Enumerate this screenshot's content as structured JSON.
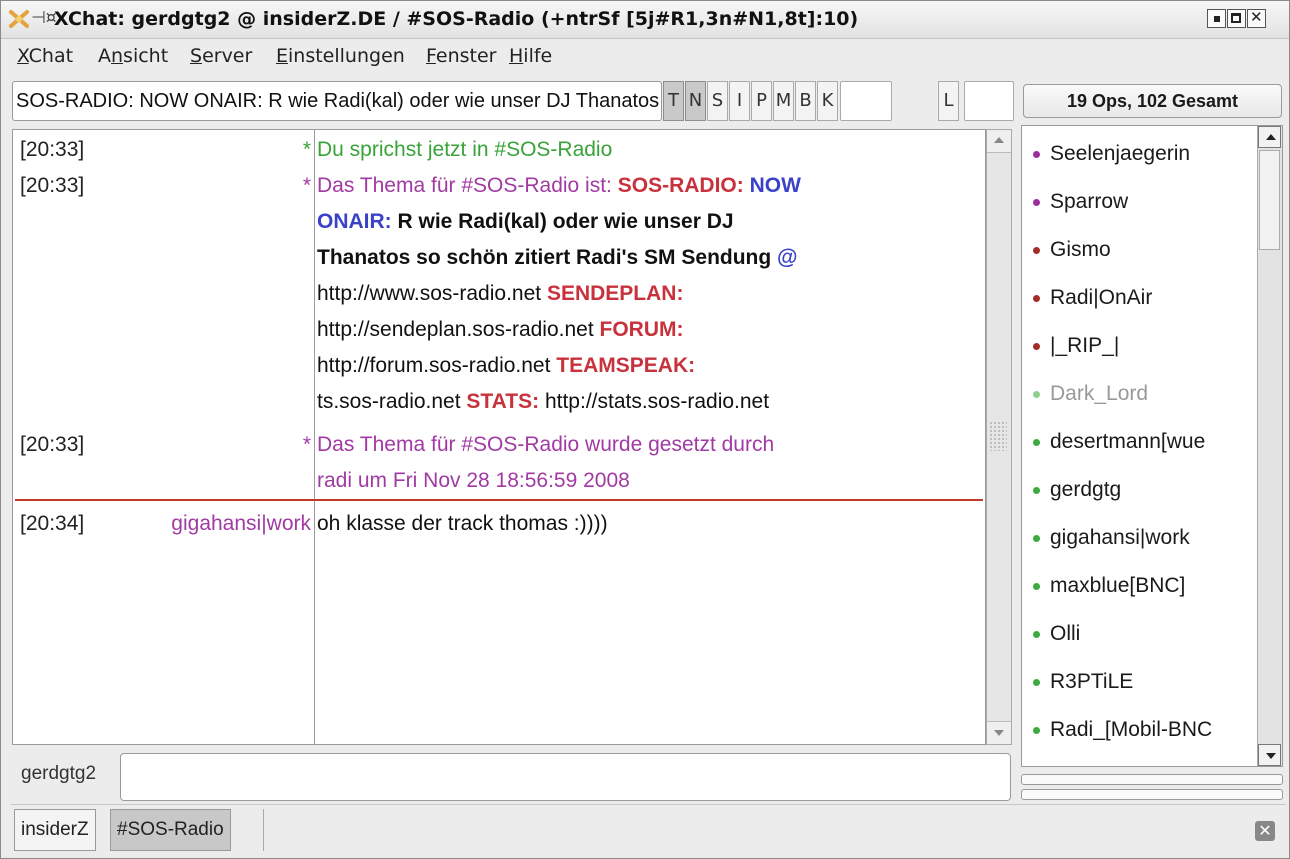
{
  "window": {
    "title": "XChat: gerdgtg2 @ insiderZ.DE / #SOS-Radio (+ntrSf [5j#R1,3n#N1,8t]:10)"
  },
  "menu": [
    {
      "accel": "X",
      "rest": "Chat"
    },
    {
      "pre": "A",
      "accel": "n",
      "rest": "sicht"
    },
    {
      "accel": "S",
      "rest": "erver"
    },
    {
      "accel": "E",
      "rest": "instellungen"
    },
    {
      "accel": "F",
      "rest": "enster"
    },
    {
      "accel": "H",
      "rest": "ilfe"
    }
  ],
  "topic": {
    "text": "SOS-RADIO: NOW ONAIR: R wie Radi(kal) oder wie unser DJ Thanatos so schön zitiert Radi's SM Sendung"
  },
  "mode_buttons": [
    "T",
    "N",
    "S",
    "I",
    "P",
    "M",
    "B",
    "K",
    "L"
  ],
  "userlist_header": "19 Ops, 102 Gesamt",
  "chat": {
    "lines": [
      {
        "time": "[20:33]",
        "nick": "*",
        "segments": [
          {
            "t": "Du sprichst jetzt in #SOS-Radio",
            "c": "green"
          }
        ]
      },
      {
        "time": "[20:33]",
        "nick": "*"
      },
      {
        "time": "[20:33]",
        "nick": "*"
      },
      {
        "time": "[20:34]",
        "nick": "gigahansi|work",
        "text": "oh klasse der track thomas :))))"
      }
    ],
    "topic_msg": {
      "l1a": "Das Thema für #SOS-Radio ist: ",
      "l1b": "SOS-RADIO: ",
      "l1c": "NOW",
      "l2a": "ONAIR: ",
      "l2b": "R wie Radi(kal) oder wie unser DJ",
      "l3a": "Thanatos so schön zitiert Radi's SM Sendung ",
      "l3b": "@",
      "l4a": "http://www.sos-radio.net  ",
      "l4b": "SENDEPLAN:",
      "l5a": "http://sendeplan.sos-radio.net  ",
      "l5b": "FORUM:",
      "l6a": "http://forum.sos-radio.net  ",
      "l6b": "TEAMSPEAK:",
      "l7a": "ts.sos-radio.net  ",
      "l7b": "STATS:",
      "l7c": " http://stats.sos-radio.net"
    },
    "set_msg": {
      "l1": "Das Thema für #SOS-Radio wurde gesetzt durch",
      "l2": "radi um Fri Nov 28 18:56:59 2008"
    }
  },
  "users": [
    {
      "name": "Seelenjaegerin",
      "status": "op-purple"
    },
    {
      "name": "Sparrow",
      "status": "op-purple"
    },
    {
      "name": "Gismo",
      "status": "op-red"
    },
    {
      "name": "Radi|OnAir",
      "status": "op-red"
    },
    {
      "name": "|_RIP_|",
      "status": "op-red"
    },
    {
      "name": "Dark_Lord",
      "status": "away"
    },
    {
      "name": "desertmann[wue",
      "status": "voice"
    },
    {
      "name": "gerdgtg",
      "status": "voice"
    },
    {
      "name": "gigahansi|work",
      "status": "voice"
    },
    {
      "name": "maxblue[BNC]",
      "status": "voice"
    },
    {
      "name": "Olli",
      "status": "voice"
    },
    {
      "name": "R3PTiLE",
      "status": "voice"
    },
    {
      "name": "Radi_[Mobil-BNC",
      "status": "voice"
    }
  ],
  "input": {
    "nick": "gerdgtg2",
    "value": ""
  },
  "tabs": [
    "insiderZ",
    "#SOS-Radio"
  ],
  "colors": {
    "green": "#38a338",
    "purple": "#a13aa3",
    "red": "#c8323c",
    "blue": "#3a42c8",
    "op_purple": "#9b2fa0",
    "op_red": "#a52a2a",
    "voice": "#3caa3c",
    "away": "#8fcf8f"
  }
}
